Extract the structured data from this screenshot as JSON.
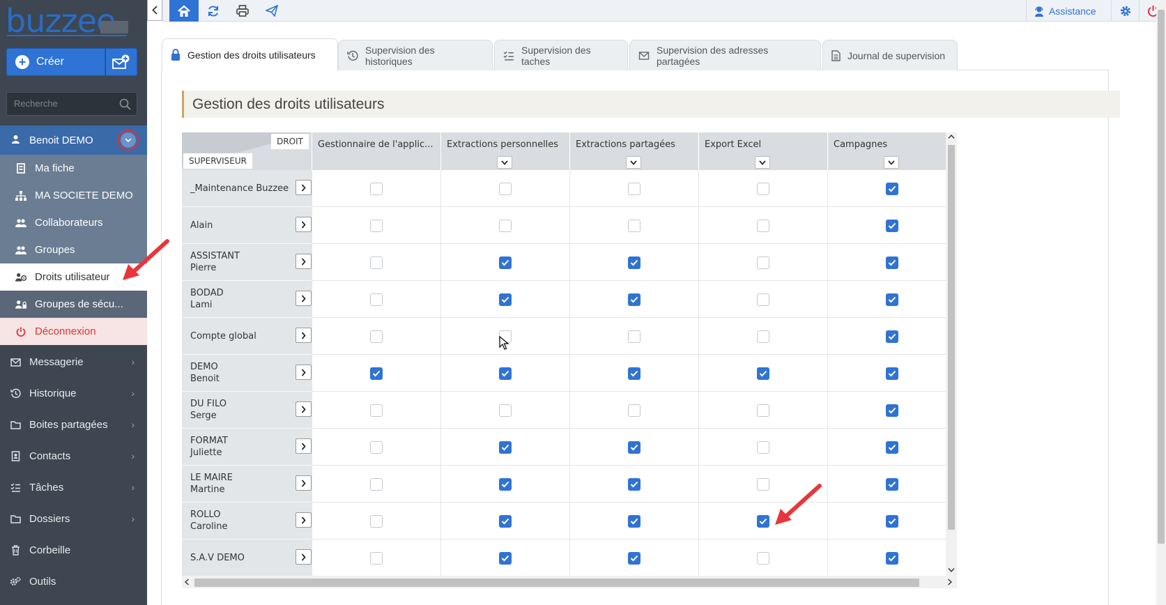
{
  "app": {
    "logo": "buzzee"
  },
  "sidebar": {
    "create_label": "Créer",
    "search_placeholder": "Recherche",
    "user": "Benoit DEMO",
    "user_menu": [
      {
        "label": "Ma fiche",
        "icon": "id-card-icon"
      },
      {
        "label": "MA SOCIETE DEMO",
        "icon": "org-chart-icon"
      },
      {
        "label": "Collaborateurs",
        "icon": "users-icon"
      },
      {
        "label": "Groupes",
        "icon": "users-icon"
      },
      {
        "label": "Droits utilisateur",
        "icon": "user-rights-icon"
      },
      {
        "label": "Groupes de sécu...",
        "icon": "user-lock-icon"
      },
      {
        "label": "Déconnexion",
        "icon": "power-icon"
      }
    ],
    "nav": [
      {
        "label": "Messagerie",
        "icon": "envelope-icon"
      },
      {
        "label": "Historique",
        "icon": "history-icon"
      },
      {
        "label": "Boites partagées",
        "icon": "folder-icon"
      },
      {
        "label": "Contacts",
        "icon": "address-book-icon"
      },
      {
        "label": "Tâches",
        "icon": "tasks-icon"
      },
      {
        "label": "Dossiers",
        "icon": "folder-icon"
      },
      {
        "label": "Corbeille",
        "icon": "trash-icon"
      },
      {
        "label": "Outils",
        "icon": "gears-icon"
      }
    ]
  },
  "topbar": {
    "assist_label": "Assistance"
  },
  "tabs": [
    {
      "label": "Gestion des droits utilisateurs",
      "icon": "lock-icon",
      "active": true
    },
    {
      "label": "Supervision des historiques",
      "icon": "history-icon",
      "active": false
    },
    {
      "label": "Supervision des taches",
      "icon": "tasks-icon",
      "active": false
    },
    {
      "label": "Supervision des adresses partagées",
      "icon": "envelope-icon",
      "active": false
    },
    {
      "label": "Journal de supervision",
      "icon": "document-icon",
      "active": false
    }
  ],
  "section_title": "Gestion des droits utilisateurs",
  "grid": {
    "corner_col": "DROIT",
    "corner_row": "SUPERVISEUR",
    "columns": [
      "Gestionnaire de l'applic...",
      "Extractions personnelles",
      "Extractions partagées",
      "Export Excel",
      "Campagnes"
    ],
    "rows": [
      {
        "line1": "_Maintenance Buzzee",
        "line2": "",
        "rights": [
          false,
          false,
          false,
          false,
          true
        ]
      },
      {
        "line1": "Alain",
        "line2": "",
        "rights": [
          false,
          false,
          false,
          false,
          true
        ]
      },
      {
        "line1": "ASSISTANT",
        "line2": "Pierre",
        "rights": [
          false,
          true,
          true,
          false,
          true
        ]
      },
      {
        "line1": "BODAD",
        "line2": "Lami",
        "rights": [
          false,
          true,
          true,
          false,
          true
        ]
      },
      {
        "line1": "Compte global",
        "line2": "",
        "rights": [
          false,
          false,
          false,
          false,
          true
        ]
      },
      {
        "line1": "DEMO",
        "line2": "Benoit",
        "rights": [
          true,
          true,
          true,
          true,
          true
        ]
      },
      {
        "line1": "DU FILO",
        "line2": "Serge",
        "rights": [
          false,
          false,
          false,
          false,
          true
        ]
      },
      {
        "line1": "FORMAT",
        "line2": "Juliette",
        "rights": [
          false,
          true,
          true,
          false,
          true
        ]
      },
      {
        "line1": "LE MAIRE",
        "line2": "Martine",
        "rights": [
          false,
          true,
          true,
          false,
          true
        ]
      },
      {
        "line1": "ROLLO",
        "line2": "Caroline",
        "rights": [
          false,
          true,
          true,
          true,
          true
        ]
      },
      {
        "line1": "S.A.V DEMO",
        "line2": "",
        "rights": [
          false,
          true,
          true,
          false,
          true
        ]
      }
    ]
  },
  "colors": {
    "accent": "#2f73d4",
    "sidebar_bg": "#3d4651",
    "annotation": "#e8353b"
  }
}
